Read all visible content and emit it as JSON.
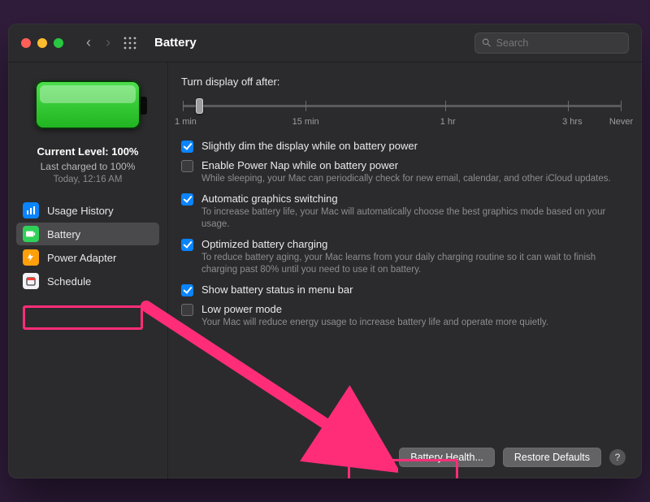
{
  "window": {
    "title": "Battery"
  },
  "search": {
    "placeholder": "Search"
  },
  "sidebar": {
    "current_level": "Current Level: 100%",
    "last_charged": "Last charged to 100%",
    "last_time": "Today, 12:16 AM",
    "items": [
      {
        "key": "usage",
        "label": "Usage History"
      },
      {
        "key": "battery",
        "label": "Battery"
      },
      {
        "key": "adapter",
        "label": "Power Adapter"
      },
      {
        "key": "schedule",
        "label": "Schedule"
      }
    ]
  },
  "main": {
    "slider_label": "Turn display off after:",
    "ticks": [
      "1 min",
      "15 min",
      "1 hr",
      "3 hrs",
      "Never"
    ],
    "options": [
      {
        "checked": true,
        "title": "Slightly dim the display while on battery power",
        "desc": ""
      },
      {
        "checked": false,
        "title": "Enable Power Nap while on battery power",
        "desc": "While sleeping, your Mac can periodically check for new email, calendar, and other iCloud updates."
      },
      {
        "checked": true,
        "title": "Automatic graphics switching",
        "desc": "To increase battery life, your Mac will automatically choose the best graphics mode based on your usage."
      },
      {
        "checked": true,
        "title": "Optimized battery charging",
        "desc": "To reduce battery aging, your Mac learns from your daily charging routine so it can wait to finish charging past 80% until you need to use it on battery."
      },
      {
        "checked": true,
        "title": "Show battery status in menu bar",
        "desc": ""
      },
      {
        "checked": false,
        "title": "Low power mode",
        "desc": "Your Mac will reduce energy usage to increase battery life and operate more quietly."
      }
    ],
    "buttons": {
      "health": "Battery Health...",
      "restore": "Restore Defaults"
    }
  }
}
